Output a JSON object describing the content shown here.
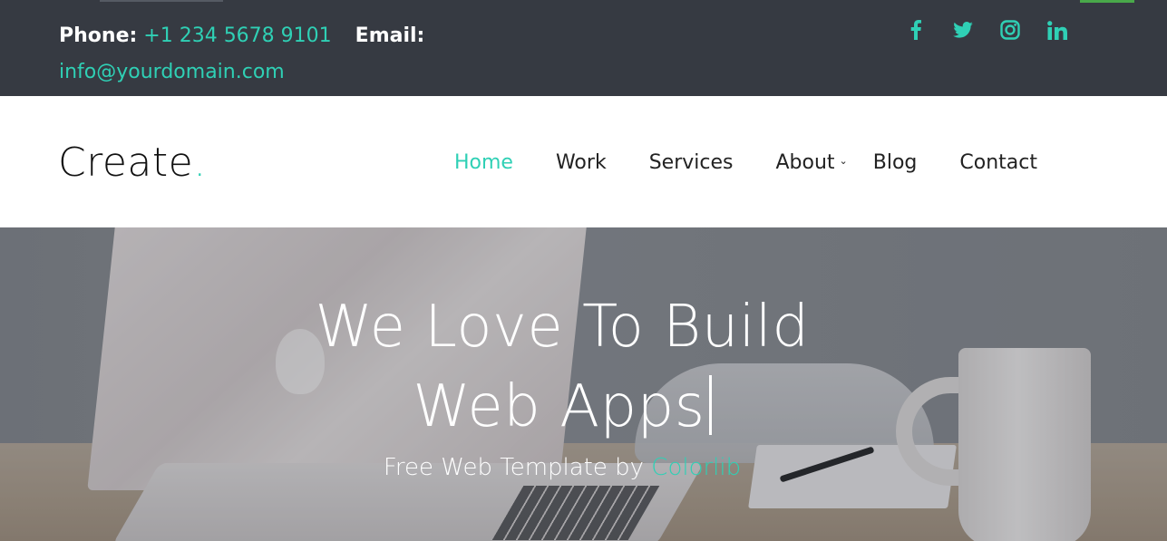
{
  "topbar": {
    "phone_label": "Phone:",
    "phone_value": "+1 234 5678 9101",
    "email_label": "Email:",
    "email_value": "info@yourdomain.com",
    "socials": [
      {
        "name": "facebook-icon",
        "glyph": "f"
      },
      {
        "name": "twitter-icon",
        "glyph": "twitter"
      },
      {
        "name": "instagram-icon",
        "glyph": "instagram"
      },
      {
        "name": "linkedin-icon",
        "glyph": "in"
      }
    ]
  },
  "navbar": {
    "logo_text": "Create",
    "logo_dot": ".",
    "menu": [
      {
        "label": "Home",
        "active": true
      },
      {
        "label": "Work",
        "active": false
      },
      {
        "label": "Services",
        "active": false
      },
      {
        "label": "About",
        "active": false,
        "dropdown": true
      },
      {
        "label": "Blog",
        "active": false
      },
      {
        "label": "Contact",
        "active": false
      }
    ]
  },
  "hero": {
    "title_line1": "We Love To Build",
    "title_line2": "Web Apps",
    "subtitle_prefix": "Free Web Template by ",
    "subtitle_link": "Colorlib"
  },
  "colors": {
    "accent": "#2fd0b5",
    "topbar_bg": "#363a42"
  }
}
